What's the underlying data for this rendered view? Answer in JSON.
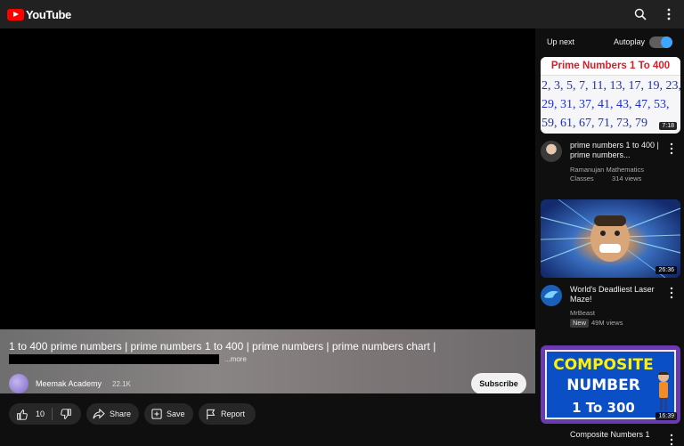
{
  "app": {
    "logo_text": "YouTube"
  },
  "player": {
    "title": "1 to 400 prime numbers | prime numbers 1 to 400 | prime numbers | prime numbers chart |",
    "more_label": "...more",
    "channel_name": "Meemak Academy",
    "subscriber_count": "22.1K",
    "subscribe_label": "Subscribe"
  },
  "actions": {
    "like_count": "10",
    "share_label": "Share",
    "save_label": "Save",
    "report_label": "Report"
  },
  "sidebar": {
    "upnext_label": "Up next",
    "autoplay_label": "Autoplay",
    "autoplay_on": true,
    "accent_color": "#3ea6ff",
    "videos": [
      {
        "thumb_heading": "Prime Numbers 1 To 400",
        "thumb_numbers": [
          "2, 3, 5, 7, 11, 13, 17, 19, 23,",
          "29, 31, 37, 41, 43, 47, 53,",
          "59, 61, 67, 71, 73, 79"
        ],
        "duration": "7:18",
        "title": "prime numbers 1 to 400 | prime numbers...",
        "channel": "Ramanujan Mathematics Classes",
        "views": "314 views"
      },
      {
        "duration": "26:36",
        "title": "World's Deadliest Laser Maze!",
        "channel": "MrBeast",
        "badge": "New",
        "views": "49M views"
      },
      {
        "thumb_lines": [
          "COMPOSITE",
          "NUMBER",
          "1 To 300"
        ],
        "duration": "16:39",
        "title": "Composite Numbers 1"
      }
    ]
  }
}
